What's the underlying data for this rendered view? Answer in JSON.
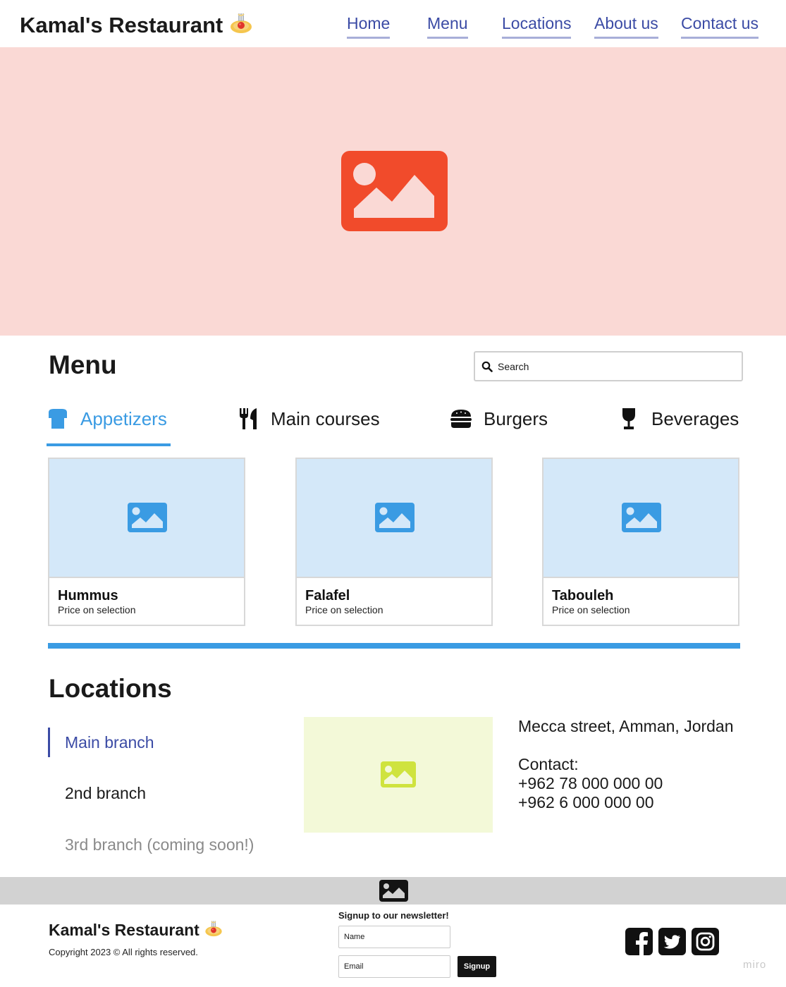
{
  "header": {
    "brand": "Kamal's Restaurant",
    "nav": [
      "Home",
      "Menu",
      "Locations",
      "About us",
      "Contact us"
    ]
  },
  "menu": {
    "title": "Menu",
    "search_placeholder": "Search",
    "tabs": [
      {
        "label": "Appetizers",
        "icon": "coffee-cup-icon",
        "active": true
      },
      {
        "label": "Main courses",
        "icon": "utensils-icon",
        "active": false
      },
      {
        "label": "Burgers",
        "icon": "burger-icon",
        "active": false
      },
      {
        "label": "Beverages",
        "icon": "wine-glass-icon",
        "active": false
      }
    ],
    "items": [
      {
        "name": "Hummus",
        "price": "Price on selection"
      },
      {
        "name": "Falafel",
        "price": "Price on selection"
      },
      {
        "name": "Tabouleh",
        "price": "Price on selection"
      }
    ]
  },
  "locations": {
    "title": "Locations",
    "branches": [
      "Main branch",
      "2nd branch",
      "3rd branch (coming soon!)"
    ],
    "address": "Mecca street, Amman, Jordan",
    "contact_label": "Contact:",
    "phones": [
      "+962 78 000 000 00",
      "+962 6 000 000 00"
    ]
  },
  "footer": {
    "brand": "Kamal's Restaurant",
    "copyright": "Copyright 2023 © All rights reserved.",
    "newsletter_title": "Signup to our newsletter!",
    "name_placeholder": "Name",
    "email_placeholder": "Email",
    "signup_label": "Signup",
    "social": [
      "facebook-icon",
      "twitter-icon",
      "instagram-icon"
    ],
    "watermark": "miro"
  },
  "colors": {
    "accent": "#3a9be3",
    "nav_link": "#3b4ba5",
    "hero_bg": "#fad9d5",
    "hero_icon": "#f14b2b",
    "card_image_bg": "#d4e8f9",
    "map_bg": "#f3f9d8",
    "map_icon": "#cfe33e"
  }
}
